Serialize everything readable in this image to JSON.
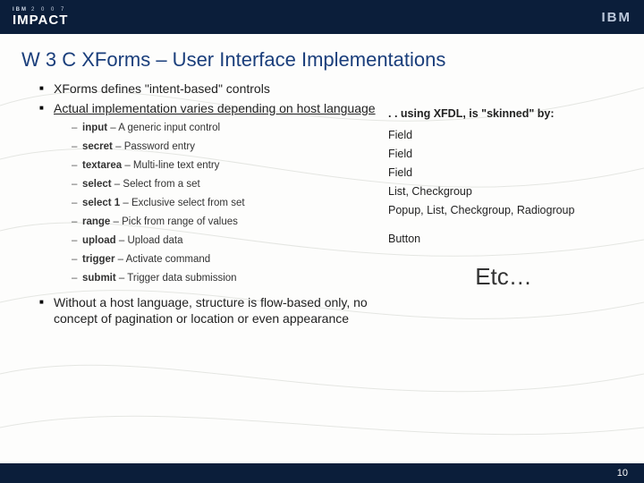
{
  "header": {
    "logo_small": "IBM",
    "logo_year": "2 0 0 7",
    "logo_word": "IMPACT",
    "ibm_right": "IBM"
  },
  "title": "W 3 C XForms – User Interface Implementations",
  "left": {
    "bullets": [
      "XForms defines \"intent-based\" controls",
      "Actual implementation varies depending on host language"
    ],
    "controls": [
      {
        "name": "input",
        "desc": "A generic input control"
      },
      {
        "name": "secret",
        "desc": "Password entry"
      },
      {
        "name": "textarea",
        "desc": "Multi-line text entry"
      },
      {
        "name": "select",
        "desc": "Select from a set"
      },
      {
        "name": "select 1",
        "desc": "Exclusive select from set"
      },
      {
        "name": "range",
        "desc": "Pick from range of values"
      },
      {
        "name": "upload",
        "desc": "Upload data"
      },
      {
        "name": "trigger",
        "desc": "Activate command"
      },
      {
        "name": "submit",
        "desc": "Trigger data submission"
      }
    ],
    "closing": "Without a host language, structure is flow-based only, no concept of pagination or location or even appearance"
  },
  "right": {
    "heading": ". . using XFDL, is \"skinned\" by:",
    "items": [
      "Field",
      "Field",
      "Field",
      "List, Checkgroup",
      "Popup, List, Checkgroup, Radiogroup",
      "Button"
    ],
    "etc": "Etc…"
  },
  "footer": {
    "page": "10"
  }
}
